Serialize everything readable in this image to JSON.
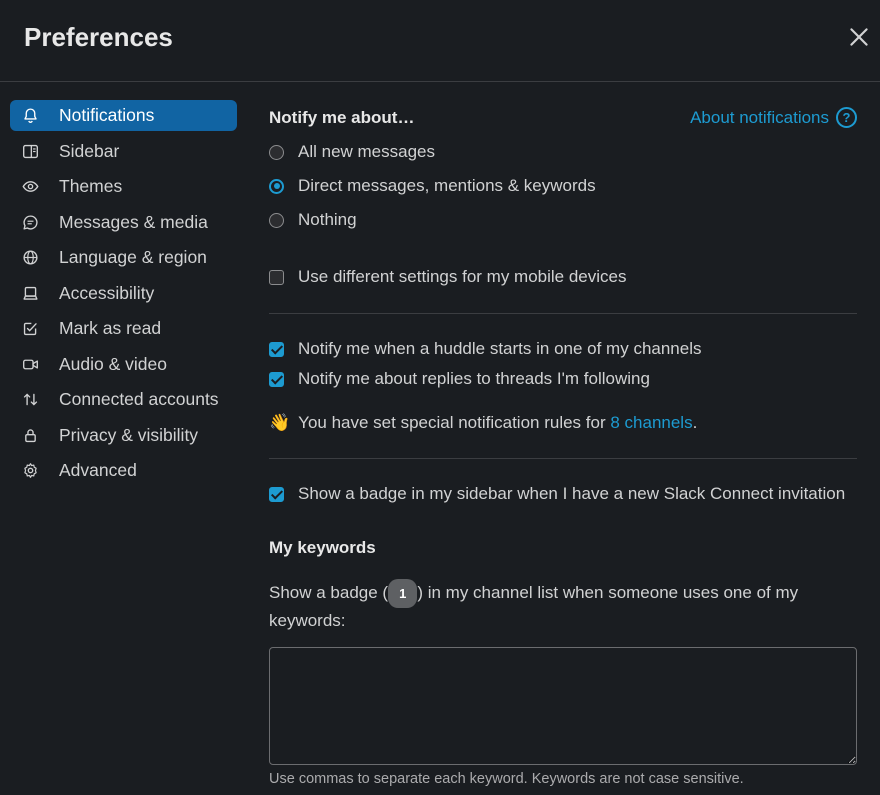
{
  "header": {
    "title": "Preferences"
  },
  "sidebar": {
    "items": [
      {
        "label": "Notifications",
        "icon": "bell-icon",
        "active": true
      },
      {
        "label": "Sidebar",
        "icon": "sidebar-icon"
      },
      {
        "label": "Themes",
        "icon": "eye-icon"
      },
      {
        "label": "Messages & media",
        "icon": "message-icon"
      },
      {
        "label": "Language & region",
        "icon": "globe-icon"
      },
      {
        "label": "Accessibility",
        "icon": "laptop-icon"
      },
      {
        "label": "Mark as read",
        "icon": "check-square-icon"
      },
      {
        "label": "Audio & video",
        "icon": "video-icon"
      },
      {
        "label": "Connected accounts",
        "icon": "arrows-icon"
      },
      {
        "label": "Privacy & visibility",
        "icon": "lock-icon"
      },
      {
        "label": "Advanced",
        "icon": "gear-icon"
      }
    ]
  },
  "main": {
    "notify_title": "Notify me about…",
    "about_link": "About notifications",
    "help_glyph": "?",
    "radios": [
      {
        "label": "All new messages",
        "checked": false
      },
      {
        "label": "Direct messages, mentions & keywords",
        "checked": true
      },
      {
        "label": "Nothing",
        "checked": false
      }
    ],
    "mobile_checkbox": {
      "label": "Use different settings for my mobile devices",
      "checked": false
    },
    "huddle_checkbox": {
      "label": "Notify me when a huddle starts in one of my channels",
      "checked": true
    },
    "threads_checkbox": {
      "label": "Notify me about replies to threads I'm following",
      "checked": true
    },
    "special_rules": {
      "emoji": "👋",
      "text_before": "You have set special notification rules for",
      "link": "8 channels",
      "text_after": "."
    },
    "badge_checkbox": {
      "label": "Show a badge in my sidebar when I have a new Slack Connect invitation",
      "checked": true
    },
    "keywords": {
      "title": "My keywords",
      "desc_before": "Show a badge (",
      "badge": "1",
      "desc_after": ") in my channel list when someone uses one of my keywords:",
      "value": "",
      "hint": "Use commas to separate each keyword. Keywords are not case sensitive."
    }
  },
  "colors": {
    "accent": "#1d9bd1",
    "active_nav": "#1164a3",
    "background": "#1a1d21"
  }
}
